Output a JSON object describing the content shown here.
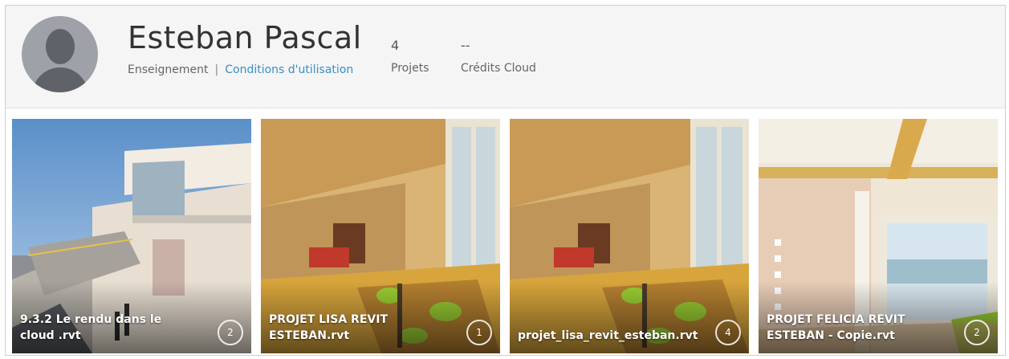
{
  "profile": {
    "name": "Esteban Pascal",
    "role": "Enseignement",
    "separator": "|",
    "terms_link": "Conditions d'utilisation",
    "stats": [
      {
        "value": "4",
        "label": "Projets"
      },
      {
        "value": "--",
        "label": "Crédits Cloud"
      }
    ]
  },
  "cards": [
    {
      "title": "9.3.2 Le rendu dans le cloud .rvt",
      "count": "2"
    },
    {
      "title": "PROJET LISA REVIT ESTEBAN.rvt",
      "count": "1"
    },
    {
      "title": "projet_lisa_revit_esteban.rvt",
      "count": "4"
    },
    {
      "title": "PROJET FELICIA REVIT ESTEBAN - Copie.rvt",
      "count": "2"
    }
  ],
  "colors": {
    "link": "#3b8fc7",
    "header_bg": "#f5f5f5"
  }
}
